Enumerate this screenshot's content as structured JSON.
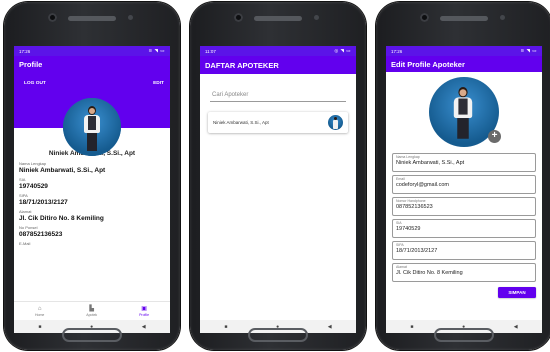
{
  "profile_screen": {
    "status_time": "17:26",
    "status_icons": "≋ ◥ ▭",
    "title": "Profile",
    "logout_label": "LOG OUT",
    "edit_label": "EDIT",
    "name": "Niniek Ambarwati, S.Si., Apt",
    "fields": [
      {
        "label": "Nama Lengkap",
        "value": "Niniek Ambarwati, S.Si., Apt"
      },
      {
        "label": "SIA",
        "value": "19740529"
      },
      {
        "label": "SIPA",
        "value": "18/71/2013/2127"
      },
      {
        "label": "Alamat",
        "value": "Jl. Cik Ditiro No. 8 Kemiling"
      },
      {
        "label": "No Ponsel",
        "value": "087852136523"
      },
      {
        "label": "E-Mail",
        "value": ""
      }
    ],
    "nav": [
      {
        "label": "Home",
        "icon": "home-icon"
      },
      {
        "label": "Apotek",
        "icon": "apotek-icon"
      },
      {
        "label": "Profile",
        "icon": "profile-icon"
      }
    ]
  },
  "list_screen": {
    "status_time": "11:07",
    "status_icons": "◎ ◥ ▭",
    "title": "DAFTAR APOTEKER",
    "search_placeholder": "Cari Apoteker",
    "items": [
      {
        "name": "Niniek Ambarwati, S.Si., Apt"
      }
    ]
  },
  "edit_screen": {
    "status_time": "17:26",
    "status_icons": "≋ ◥ ▭",
    "title": "Edit Profile Apoteker",
    "fields": [
      {
        "label": "Nama Lengkap",
        "value": "Niniek Ambarwati, S.Si., Apt"
      },
      {
        "label": "Email",
        "value": "codeforyl@gmail.com"
      },
      {
        "label": "Nomor Handphone",
        "value": "087852136523"
      },
      {
        "label": "SIA",
        "value": "19740529"
      },
      {
        "label": "SIPA",
        "value": "18/71/2013/2127"
      },
      {
        "label": "Alamat",
        "value": "Jl. Cik Ditiro No. 8 Kemiling"
      }
    ],
    "save_label": "SIMPAN"
  },
  "colors": {
    "accent": "#6200ee",
    "status": "#5b14e8"
  }
}
